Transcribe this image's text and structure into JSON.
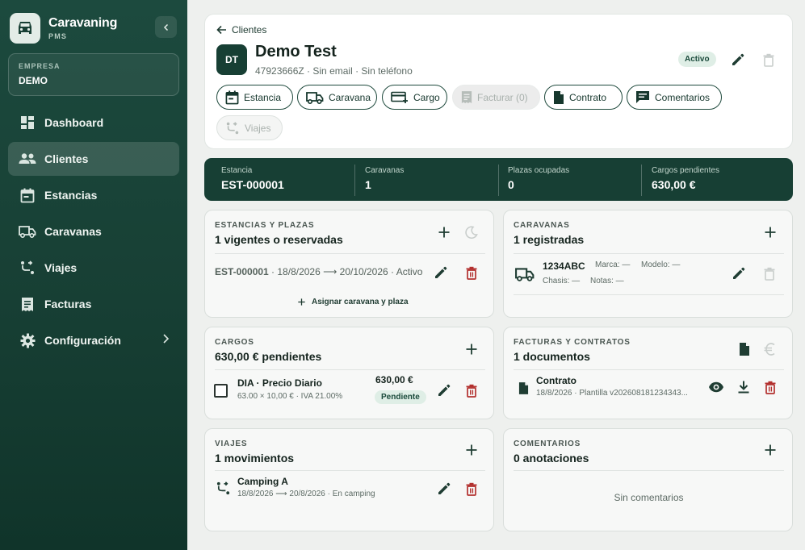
{
  "sidebar": {
    "brand_name": "Caravaning",
    "brand_sub": "PMS",
    "company_label": "EMPRESA",
    "company_name": "DEMO",
    "items": [
      {
        "label": "Dashboard",
        "icon": "dashboard-icon"
      },
      {
        "label": "Clientes",
        "icon": "people-icon",
        "active": true
      },
      {
        "label": "Estancias",
        "icon": "calendar-icon"
      },
      {
        "label": "Caravanas",
        "icon": "truck-icon"
      },
      {
        "label": "Viajes",
        "icon": "route-icon"
      },
      {
        "label": "Facturas",
        "icon": "receipt-icon"
      },
      {
        "label": "Configuración",
        "icon": "gear-icon"
      }
    ]
  },
  "header": {
    "back_label": "Clientes",
    "avatar_initials": "DT",
    "client_name": "Demo Test",
    "client_meta": "47923666Z · Sin email · Sin teléfono",
    "status": "Activo",
    "actions": [
      {
        "label": "Estancia",
        "icon": "calendar-icon"
      },
      {
        "label": "Caravana",
        "icon": "truck-icon"
      },
      {
        "label": "Cargo",
        "icon": "add-card-icon"
      },
      {
        "label": "Facturar (0)",
        "icon": "receipt-icon",
        "disabled": true
      },
      {
        "label": "Contrato",
        "icon": "document-icon"
      },
      {
        "label": "Comentarios",
        "icon": "comment-icon"
      },
      {
        "label": "Viajes",
        "icon": "route-icon",
        "disabled": true
      }
    ]
  },
  "stats": [
    {
      "label": "Estancia",
      "value": "EST-000001"
    },
    {
      "label": "Caravanas",
      "value": "1"
    },
    {
      "label": "Plazas ocupadas",
      "value": "0"
    },
    {
      "label": "Cargos pendientes",
      "value": "630,00 €"
    }
  ],
  "estancias": {
    "eyebrow": "ESTANCIAS Y PLAZAS",
    "title": "1 vigentes o reservadas",
    "row_code": "EST-000001",
    "row_detail": " · 18/8/2026 ⟶ 20/10/2026 · Activo",
    "assign_label": "Asignar caravana y plaza"
  },
  "caravanas": {
    "eyebrow": "CARAVANAS",
    "title": "1 registradas",
    "plate": "1234ABC",
    "marca": "Marca: —",
    "modelo": "Modelo: —",
    "chasis": "Chasis: —",
    "notas": "Notas: —"
  },
  "cargos": {
    "eyebrow": "CARGOS",
    "title": "630,00 € pendientes",
    "item_name": "DIA · Precio Diario",
    "item_detail": "63.00 × 10,00 € · IVA 21.00%",
    "item_amount": "630,00 €",
    "item_status": "Pendiente"
  },
  "facturas": {
    "eyebrow": "FACTURAS Y CONTRATOS",
    "title": "1 documentos",
    "doc_name": "Contrato",
    "doc_detail": "18/8/2026 · Plantilla v202608181234343..."
  },
  "viajes": {
    "eyebrow": "VIAJES",
    "title": "1 movimientos",
    "trip_name": "Camping A",
    "trip_detail": "18/8/2026 ⟶ 20/8/2026 · En camping"
  },
  "comentarios": {
    "eyebrow": "COMENTARIOS",
    "title": "0 anotaciones",
    "empty": "Sin comentarios"
  },
  "colors": {
    "primary": "#173f34",
    "danger": "#b3312f",
    "accent_soft": "#dfeee6"
  }
}
